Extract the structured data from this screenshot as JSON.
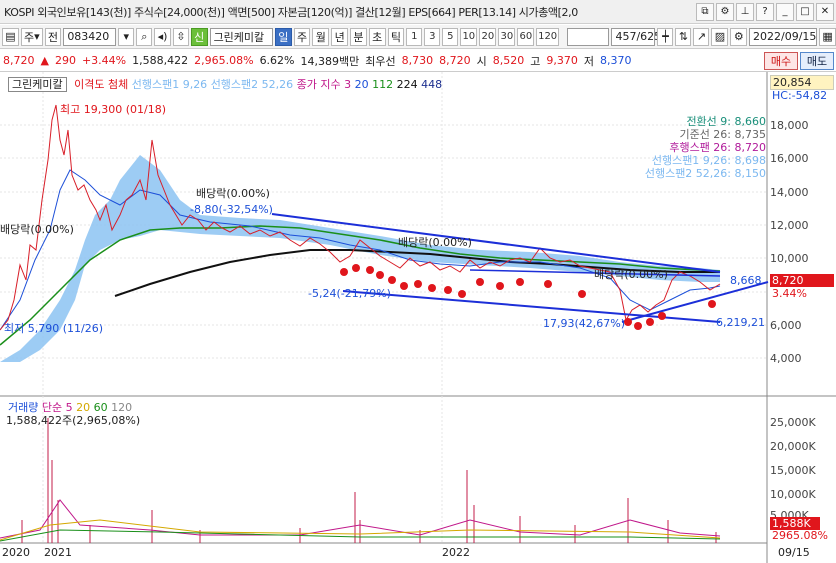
{
  "header": {
    "info": "KOSPI 외국인보유[143(천)] 주식수[24,000(천)] 액면[500] 자본금[120(억)] 결산[12월] EPS[664] PER[13.14] 시가총액[2,0"
  },
  "toolbar": {
    "market": "주",
    "full": "전",
    "code": "083420",
    "name_tag": "신",
    "name": "그린케미칼",
    "periods": [
      "일",
      "주",
      "월",
      "년",
      "분",
      "초",
      "틱"
    ],
    "minutes": [
      "1",
      "3",
      "5",
      "10",
      "20",
      "30",
      "60",
      "120"
    ],
    "counter": "457/625",
    "date": "2022/09/15"
  },
  "quote": {
    "price": "8,720",
    "arrow": "▲",
    "change": "290",
    "pct": "+3.44%",
    "volume": "1,588,422",
    "vol_ratio": "2,965.08%",
    "turnover": "6.62%",
    "amount": "14,389백만",
    "best_ask_label": "최우선",
    "best_ask": "8,730",
    "best_bid": "8,720",
    "open_label": "시",
    "open": "8,520",
    "high_label": "고",
    "high": "9,370",
    "low_label": "저",
    "low": "8,370",
    "buy": "매수",
    "sell": "매도"
  },
  "legend": {
    "name": "그린케미칼",
    "items": [
      {
        "text": "이격도 첨체",
        "color": "#e0161c"
      },
      {
        "text": "선행스팬1 9,26",
        "color": "#7cb8f0"
      },
      {
        "text": "선행스팬2 52,26",
        "color": "#7cb8f0"
      },
      {
        "text": "종가 지수 3",
        "color": "#c0178a"
      },
      {
        "text": "20",
        "color": "#1c4fd8"
      },
      {
        "text": "112",
        "color": "#1a8f1a"
      },
      {
        "text": "224",
        "color": "#111111"
      },
      {
        "text": "448",
        "color": "#1c2f8f"
      }
    ]
  },
  "indicators": [
    {
      "text": "전환선 9: 8,660",
      "color": "#1a8f7a"
    },
    {
      "text": "기준선 26: 8,735",
      "color": "#666666"
    },
    {
      "text": "후행스팬 26: 8,720",
      "color": "#b01a9a"
    },
    {
      "text": "선행스팬1 9,26: 8,698",
      "color": "#7cb8f0"
    },
    {
      "text": "선행스팬2 52,26: 8,150",
      "color": "#7cb8f0"
    }
  ],
  "price_axis": [
    "18,000",
    "16,000",
    "14,000",
    "12,000",
    "10,000",
    "8,000",
    "6,000",
    "4,000"
  ],
  "price_tags": {
    "top": "20,854",
    "hc": "HC:-54,82",
    "current": "8,720",
    "current_pct": "3.44%"
  },
  "annotations": {
    "high": "최고 19,300 (01/18)",
    "low": "최저 5,790 (11/26)",
    "div1": "배당락(0.00%)",
    "div2": "배당락(0.00%)",
    "div3": "배당락(0.00%)",
    "div4": "배당락(0.00%)",
    "tl1": "-8,80(-32,54%)",
    "tl2": "-5,24(-21,79%)",
    "tl3": "17,93(42,67%)",
    "tl4": "6,219,21",
    "tl5": "8,668"
  },
  "volume": {
    "label": "거래량",
    "ma": [
      {
        "text": "단순 5",
        "color": "#c0178a"
      },
      {
        "text": "20",
        "color": "#d4a800"
      },
      {
        "text": "60",
        "color": "#1a8f1a"
      },
      {
        "text": "120",
        "color": "#888888"
      }
    ],
    "sub": "1,588,422주(2,965,08%)",
    "axis": [
      "25,000K",
      "20,000K",
      "15,000K",
      "10,000K",
      "5,000K"
    ],
    "tag1": "1,588K",
    "tag2": "2965.08%"
  },
  "xaxis": [
    "2020",
    "2021",
    "2022",
    "09/15"
  ],
  "colors": {
    "up": "#e0161c",
    "down": "#1c4fd8",
    "cloud": "#8cc3f2"
  }
}
